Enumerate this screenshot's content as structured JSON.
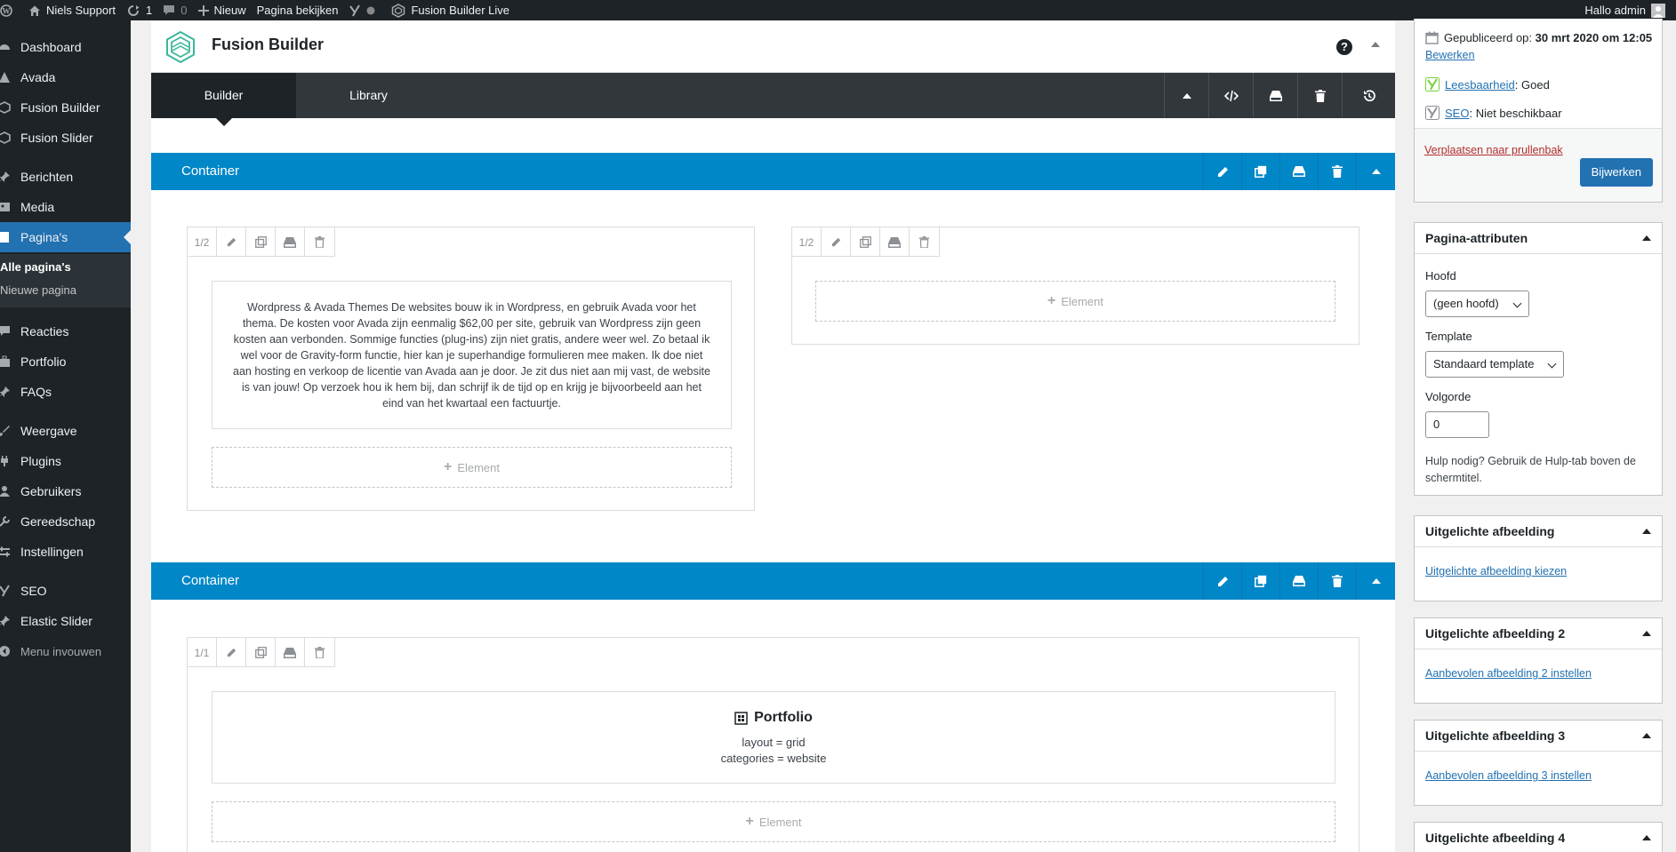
{
  "adminbar": {
    "site_name": "Niels Support",
    "updates_count": "1",
    "comments_count": "0",
    "new_label": "Nieuw",
    "view_page_label": "Pagina bekijken",
    "live_label": "Fusion Builder Live",
    "greeting": "Hallo admin"
  },
  "sidebar": {
    "items": [
      {
        "label": "Dashboard",
        "icon": "dashboard-icon"
      },
      {
        "label": "Avada",
        "icon": "avada-icon"
      },
      {
        "label": "Fusion Builder",
        "icon": "fusion-builder-icon"
      },
      {
        "label": "Fusion Slider",
        "icon": "fusion-slider-icon"
      },
      {
        "label": "Berichten",
        "icon": "pin-icon"
      },
      {
        "label": "Media",
        "icon": "media-icon"
      },
      {
        "label": "Pagina's",
        "icon": "page-icon"
      },
      {
        "label": "Reacties",
        "icon": "comment-icon"
      },
      {
        "label": "Portfolio",
        "icon": "portfolio-icon"
      },
      {
        "label": "FAQs",
        "icon": "faq-icon"
      },
      {
        "label": "Weergave",
        "icon": "brush-icon"
      },
      {
        "label": "Plugins",
        "icon": "plug-icon"
      },
      {
        "label": "Gebruikers",
        "icon": "users-icon"
      },
      {
        "label": "Gereedschap",
        "icon": "wrench-icon"
      },
      {
        "label": "Instellingen",
        "icon": "settings-icon"
      },
      {
        "label": "SEO",
        "icon": "yoast-icon"
      },
      {
        "label": "Elastic Slider",
        "icon": "pin-icon"
      },
      {
        "label": "Menu invouwen",
        "icon": "collapse-icon"
      }
    ],
    "submenu": [
      "Alle pagina's",
      "Nieuwe pagina"
    ]
  },
  "builder": {
    "title": "Fusion Builder",
    "help": "?",
    "tabs": [
      "Builder",
      "Library"
    ],
    "containers": [
      {
        "title": "Container",
        "columns": [
          {
            "size": "1/2",
            "text": "Wordpress & Avada Themes De websites bouw ik in Wordpress, en gebruik Avada voor het thema. De kosten voor Avada zijn eenmalig $62,00 per site, gebruik van Wordpress zijn geen kosten aan verbonden. Sommige functies (plug-ins) zijn niet gratis, andere weer wel. Zo betaal ik wel voor de Gravity-form functie, hier kan je superhandige formulieren mee maken. Ik doe niet aan hosting en verkoop de licentie van Avada aan je door. Je zit dus niet aan mij vast, de website is van jouw! Op verzoek hou ik hem bij, dan schrijf ik de tijd op en krijg je bijvoorbeeld aan het eind van het kwartaal een factuurtje.",
            "add_label": "Element"
          },
          {
            "size": "1/2",
            "add_label": "Element"
          }
        ]
      },
      {
        "title": "Container",
        "columns": [
          {
            "size": "1/1",
            "element_title": "Portfolio",
            "element_line1": "layout = grid",
            "element_line2": "categories = website",
            "add_label": "Element"
          }
        ]
      }
    ]
  },
  "publish": {
    "published_label": "Gepubliceerd op:",
    "published_date": "30 mrt 2020 om 12:05",
    "edit_link": "Bewerken",
    "readability_link": "Leesbaarheid",
    "readability_value": ": Goed",
    "seo_link": "SEO",
    "seo_value": ": Niet beschikbaar",
    "trash_link": "Verplaatsen naar prullenbak",
    "update_button": "Bijwerken"
  },
  "attributes": {
    "title": "Pagina-attributen",
    "parent_label": "Hoofd",
    "parent_value": "(geen hoofd)",
    "template_label": "Template",
    "template_value": "Standaard template",
    "order_label": "Volgorde",
    "order_value": "0",
    "help_text": "Hulp nodig? Gebruik de Hulp-tab boven de schermtitel."
  },
  "featured_boxes": [
    {
      "title": "Uitgelichte afbeelding",
      "link": "Uitgelichte afbeelding kiezen"
    },
    {
      "title": "Uitgelichte afbeelding 2",
      "link": "Aanbevolen afbeelding 2 instellen"
    },
    {
      "title": "Uitgelichte afbeelding 3",
      "link": "Aanbevolen afbeelding 3 instellen"
    },
    {
      "title": "Uitgelichte afbeelding 4"
    }
  ],
  "colors": {
    "accent": "#0087c8",
    "admin_dark": "#1d2327",
    "wp_blue": "#2271b1"
  }
}
